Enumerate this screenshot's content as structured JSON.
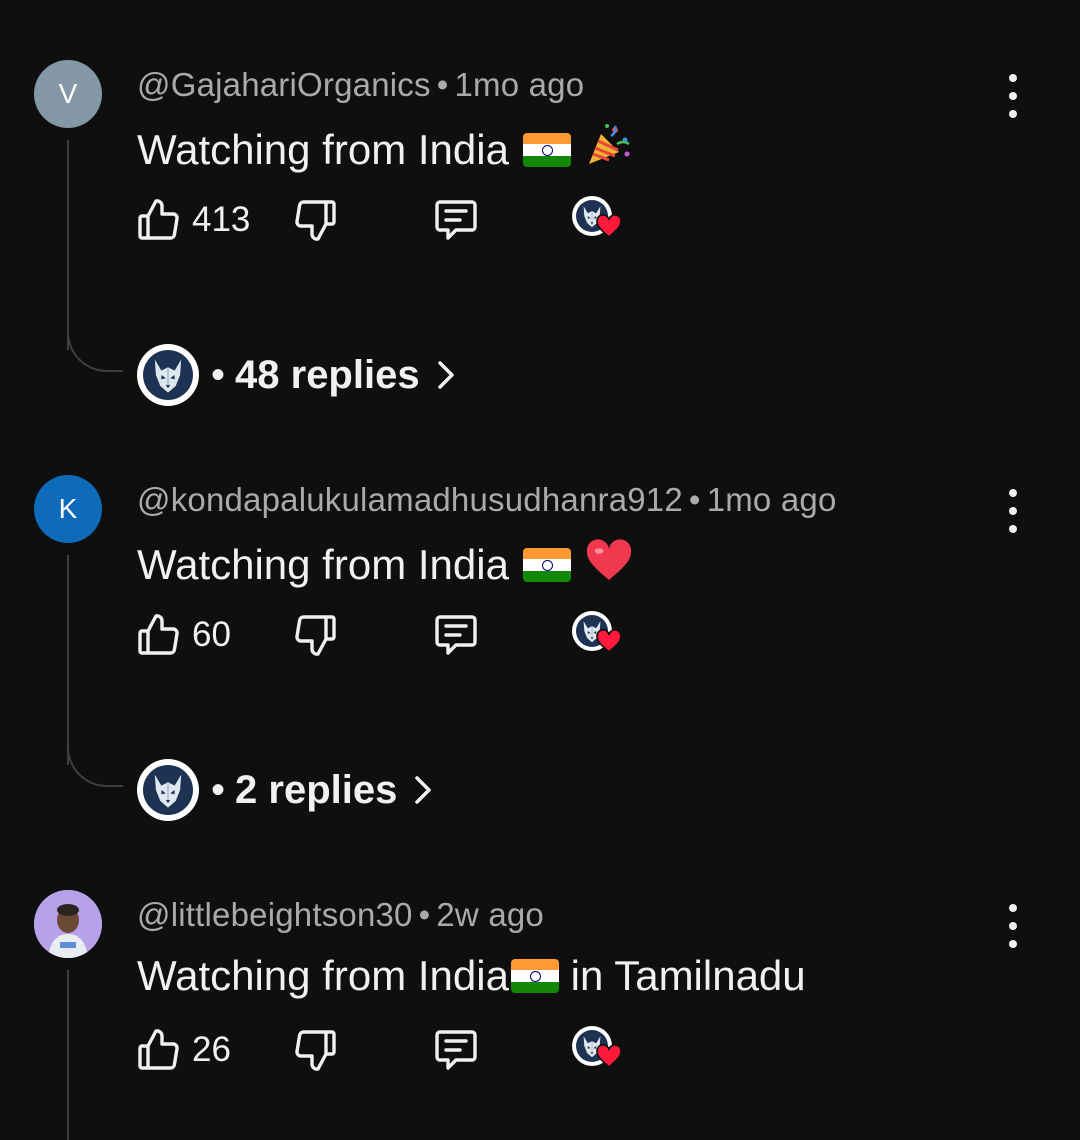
{
  "comments": [
    {
      "avatar_letter": "V",
      "avatar_color": "#8397a5",
      "handle": "@GajahariOrganics",
      "separator": "•",
      "time": "1mo ago",
      "text": "Watching from India",
      "emoji": "party-popper",
      "likes": "413",
      "replies_separator": "•",
      "replies_label": "48 replies"
    },
    {
      "avatar_letter": "K",
      "avatar_color": "#0d6bba",
      "handle": "@kondapalukulamadhusudhanra912",
      "separator": "•",
      "time": "1mo ago",
      "text": "Watching from India",
      "emoji": "red-heart",
      "likes": "60",
      "replies_separator": "•",
      "replies_label": "2 replies"
    },
    {
      "avatar_letter": "",
      "handle": "@littlebeightson30",
      "separator": "•",
      "time": "2w ago",
      "text_before": "Watching from India",
      "text_after": " in Tamilnadu",
      "likes": "26"
    }
  ],
  "colors": {
    "background": "#0f0f0f",
    "text": "#f1f1f1",
    "meta": "#aaaaaa",
    "thread": "#3f3f3f",
    "heart": "#ff0033"
  },
  "icons": [
    "thumbs-up-icon",
    "thumbs-down-icon",
    "reply-icon",
    "creator-heart-icon",
    "more-options-icon",
    "chevron-right-icon",
    "creator-avatar-icon",
    "india-flag-icon"
  ]
}
